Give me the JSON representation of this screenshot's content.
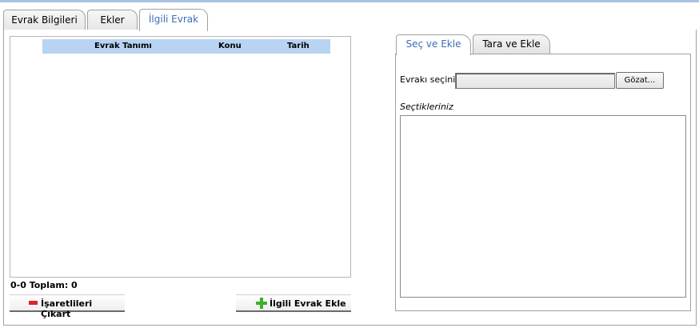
{
  "tabs": [
    {
      "label": "Evrak Bilgileri",
      "active": false
    },
    {
      "label": "Ekler",
      "active": false
    },
    {
      "label": "İlgili Evrak",
      "active": true
    }
  ],
  "grid": {
    "columns": [
      "Evrak Tanımı",
      "Konu",
      "Tarih"
    ],
    "rows": []
  },
  "status": {
    "total_label": "0-0 Toplam: 0"
  },
  "buttons": {
    "remove_marked": "İşaretlileri Çıkart",
    "add_related": "İlgili Evrak Ekle"
  },
  "right": {
    "subtabs": [
      {
        "label": "Seç ve Ekle",
        "active": true
      },
      {
        "label": "Tara ve Ekle",
        "active": false
      }
    ],
    "select_label": "Evrakı seçiniz :",
    "file_value": "",
    "browse_label": "Gözat...",
    "selections_label": "Seçtikleriniz"
  },
  "colors": {
    "accent_text": "#3a6fb7",
    "grid_header": "#b9d3f2",
    "remove_icon": "#d9262b",
    "add_icon": "#3fae2a"
  }
}
